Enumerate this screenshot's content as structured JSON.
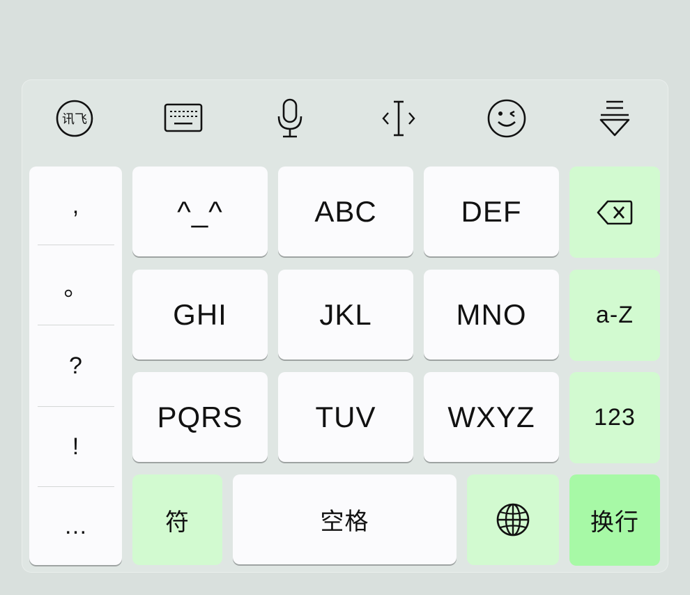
{
  "toolbar": {
    "items": [
      {
        "name": "ifly-logo",
        "label": "讯飞"
      },
      {
        "name": "keyboard-toggle"
      },
      {
        "name": "voice-input"
      },
      {
        "name": "cursor-move"
      },
      {
        "name": "emoji"
      },
      {
        "name": "hide-keyboard"
      }
    ]
  },
  "punctuation": [
    ",",
    "。",
    "?",
    "!",
    "…"
  ],
  "keys": {
    "row1": [
      "^_^",
      "ABC",
      "DEF"
    ],
    "row2": [
      "GHI",
      "JKL",
      "MNO"
    ],
    "row3": [
      "PQRS",
      "TUV",
      "WXYZ"
    ],
    "case_toggle": "a-Z",
    "numbers": "123",
    "symbols": "符",
    "space": "空格",
    "enter": "换行"
  },
  "colors": {
    "background": "#d9e0dd",
    "key": "#fbfbfd",
    "function_key": "#d2fad0",
    "enter_key": "#a7f9a6"
  }
}
